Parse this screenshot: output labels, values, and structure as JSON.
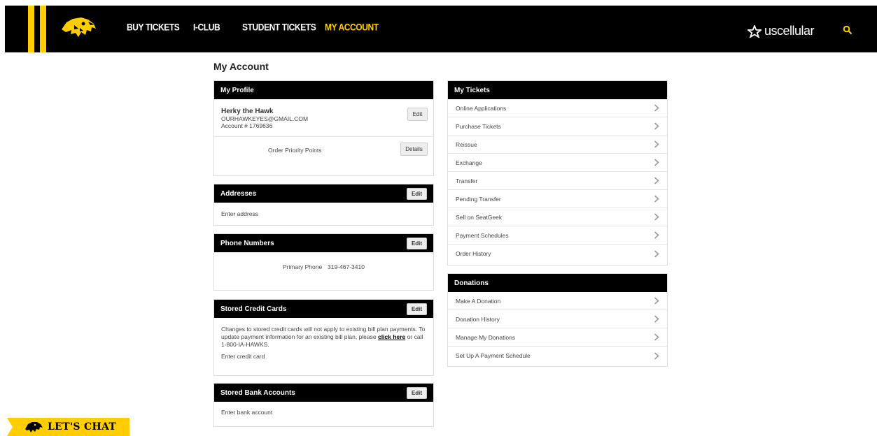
{
  "nav": {
    "items": [
      "Buy Tickets",
      "I-Club",
      "Student Tickets",
      "My Account"
    ],
    "active": "My Account",
    "brand": "uscellular",
    "accent": "#ffcd00"
  },
  "page_title": "My Account",
  "profile": {
    "header": "My Profile",
    "name": "Herky the Hawk",
    "email": "OURHAWKEYES@GMAIL.COM",
    "account": "Account # 1769636",
    "edit": "Edit",
    "priority_label": "Order Priority Points",
    "details": "Details"
  },
  "addresses": {
    "header": "Addresses",
    "edit": "Edit",
    "body": "Enter address"
  },
  "phones": {
    "header": "Phone Numbers",
    "edit": "Edit",
    "label": "Primary Phone",
    "value": "319-467-3410"
  },
  "credit_cards": {
    "header": "Stored Credit Cards",
    "edit": "Edit",
    "note_pre": "Changes to stored credit cards will not apply to existing bill plan payments. To update payment information for an existing bill plan, please ",
    "note_link": "click here",
    "note_post": " or call 1-800-IA-HAWKS.",
    "body": "Enter credit card"
  },
  "bank_accounts": {
    "header": "Stored Bank Accounts",
    "edit": "Edit",
    "body": "Enter bank account"
  },
  "tickets": {
    "header": "My Tickets",
    "items": [
      "Online Applications",
      "Purchase Tickets",
      "Reissue",
      "Exchange",
      "Transfer",
      "Pending Transfer",
      "Sell on SeatGeek",
      "Payment Schedules",
      "Order History"
    ]
  },
  "donations": {
    "header": "Donations",
    "items": [
      "Make A Donation",
      "Donation History",
      "Manage My Donations",
      "Set Up A Payment Schedule"
    ]
  },
  "chat": {
    "label": "LET'S CHAT"
  }
}
